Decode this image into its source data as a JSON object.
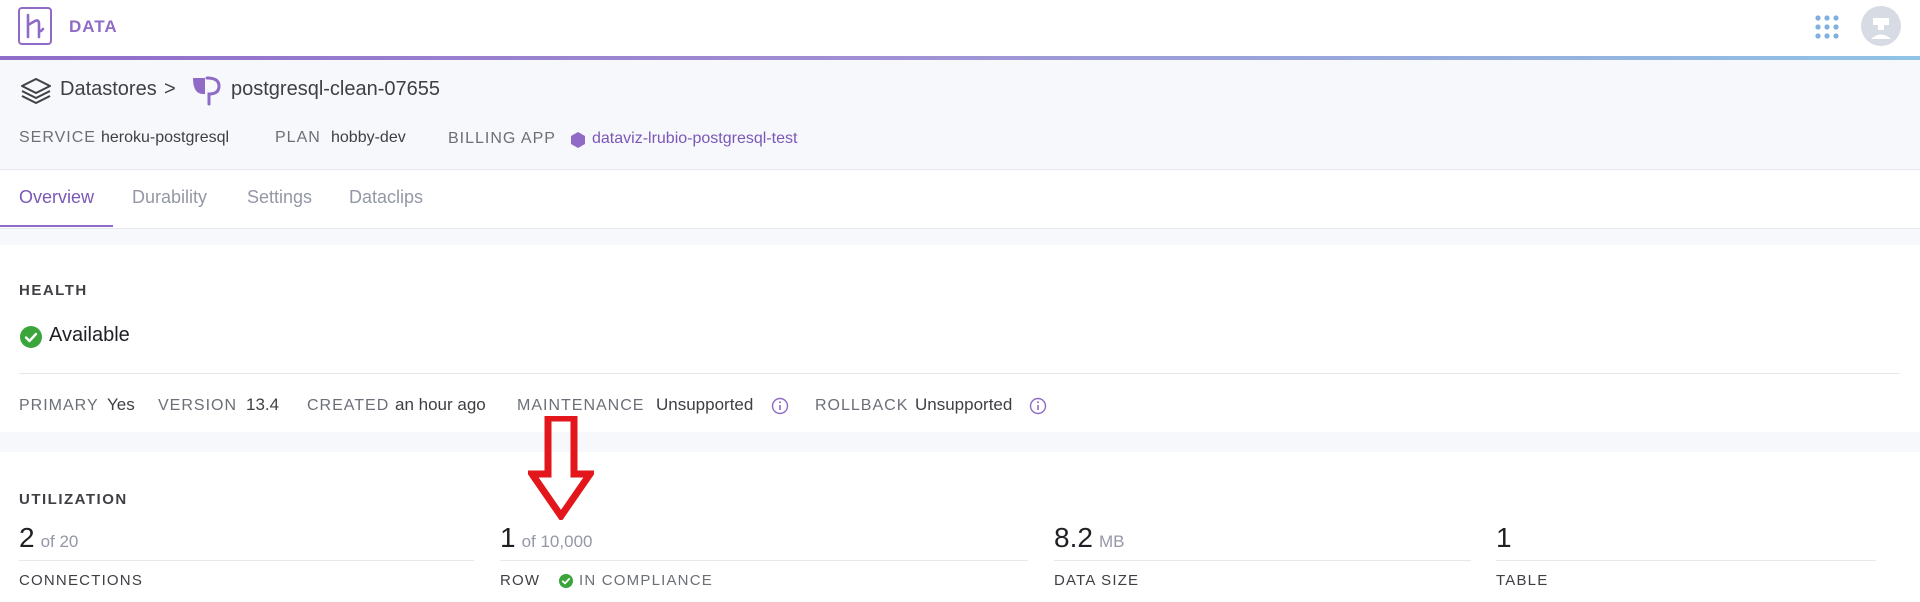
{
  "app": {
    "name": "DATA"
  },
  "breadcrumb": {
    "root": "Datastores",
    "separator": ">",
    "current": "postgresql-clean-07655"
  },
  "meta": {
    "service_label": "SERVICE",
    "service_value": "heroku-postgresql",
    "plan_label": "PLAN",
    "plan_value": "hobby-dev",
    "billing_label": "BILLING APP",
    "billing_value": "dataviz-lrubio-postgresql-test"
  },
  "tabs": [
    {
      "label": "Overview",
      "active": true
    },
    {
      "label": "Durability",
      "active": false
    },
    {
      "label": "Settings",
      "active": false
    },
    {
      "label": "Dataclips",
      "active": false
    }
  ],
  "health": {
    "title": "HEALTH",
    "status": "Available",
    "primary_label": "PRIMARY",
    "primary_value": "Yes",
    "version_label": "VERSION",
    "version_value": "13.4",
    "created_label": "CREATED",
    "created_value": "an hour ago",
    "maintenance_label": "MAINTENANCE",
    "maintenance_value": "Unsupported",
    "rollback_label": "ROLLBACK",
    "rollback_value": "Unsupported"
  },
  "utilization": {
    "title": "UTILIZATION",
    "connections": {
      "value": "2",
      "limit": "of 20",
      "label": "CONNECTIONS"
    },
    "rows": {
      "value": "1",
      "limit": "of 10,000",
      "label": "ROW",
      "compliance": "IN COMPLIANCE"
    },
    "data_size": {
      "value": "8.2",
      "unit": "MB",
      "label": "DATA SIZE"
    },
    "tables": {
      "value": "1",
      "label": "TABLE"
    }
  },
  "colors": {
    "accent": "#8f6bc7",
    "success": "#3aa53a",
    "annotation": "#e3161b"
  },
  "icons": {
    "logo": "heroku-logo-icon",
    "apps": "apps-grid-icon",
    "avatar": "user-avatar",
    "datastores": "layers-icon",
    "postgres": "postgres-elephant-icon",
    "billing": "hexagon-app-icon",
    "status": "check-circle-icon",
    "info": "info-icon",
    "annotation": "red-down-arrow"
  }
}
